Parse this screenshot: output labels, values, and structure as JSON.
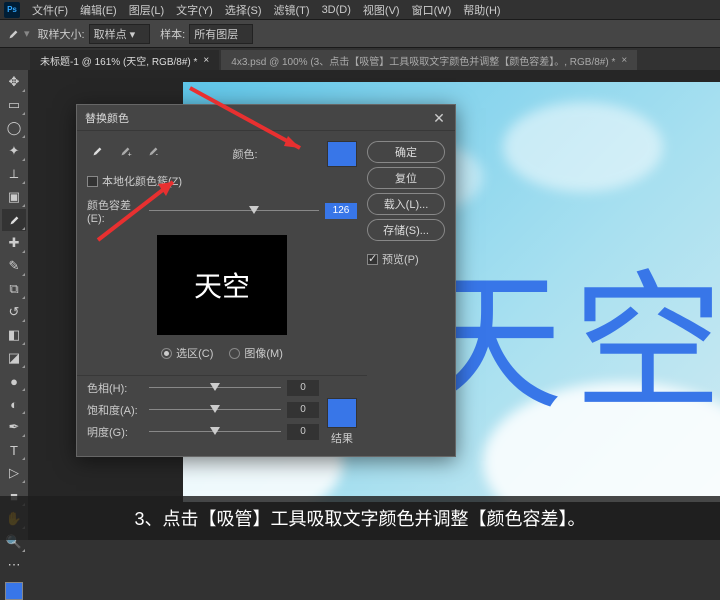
{
  "menu": {
    "items": [
      "文件(F)",
      "编辑(E)",
      "图层(L)",
      "文字(Y)",
      "选择(S)",
      "滤镜(T)",
      "3D(D)",
      "视图(V)",
      "窗口(W)",
      "帮助(H)"
    ]
  },
  "optbar": {
    "sample_size_label": "取样大小:",
    "sample_size_value": "取样点",
    "sample_label": "样本:",
    "sample_value": "所有图层"
  },
  "tabs": [
    {
      "label": "未标题-1 @ 161% (天空, RGB/8#) *",
      "active": true
    },
    {
      "label": "4x3.psd @ 100% (3、点击【吸管】工具吸取文字颜色并调整【颜色容差】。, RGB/8#) *",
      "active": false
    }
  ],
  "canvas": {
    "text": "天空"
  },
  "dialog": {
    "title": "替换颜色",
    "localize_label": "本地化颜色簇(Z)",
    "color_label": "颜色:",
    "fuzziness_label": "颜色容差(E):",
    "fuzziness_value": "126",
    "preview_text": "天空",
    "radio_selection": "选区(C)",
    "radio_image": "图像(M)",
    "hue_label": "色相(H):",
    "hue_value": "0",
    "sat_label": "饱和度(A):",
    "sat_value": "0",
    "light_label": "明度(G):",
    "light_value": "0",
    "result_label": "结果",
    "buttons": {
      "ok": "确定",
      "cancel": "复位",
      "load": "载入(L)...",
      "save": "存储(S)..."
    },
    "preview_cb": "预览(P)"
  },
  "colors": {
    "accent": "#3876e8"
  },
  "caption": "3、点击【吸管】工具吸取文字颜色并调整【颜色容差】。"
}
